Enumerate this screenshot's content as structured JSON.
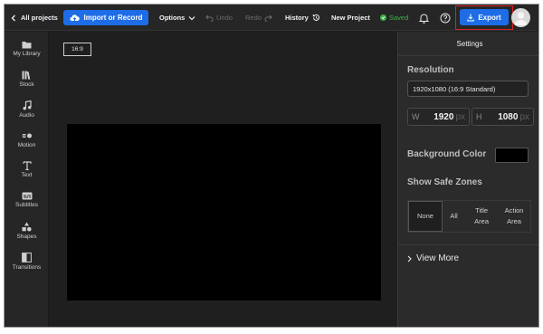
{
  "topbar": {
    "all_projects": "All projects",
    "import_record": "Import or Record",
    "options": "Options",
    "undo": "Undo",
    "redo": "Redo",
    "history": "History",
    "new_project": "New Project",
    "saved": "Saved",
    "export": "Export"
  },
  "sidebar": {
    "items": [
      {
        "label": "My Library",
        "icon": "folder-icon"
      },
      {
        "label": "Stock",
        "icon": "stock-icon"
      },
      {
        "label": "Audio",
        "icon": "music-note-icon"
      },
      {
        "label": "Motion",
        "icon": "motion-icon"
      },
      {
        "label": "Text",
        "icon": "text-icon"
      },
      {
        "label": "Subtitles",
        "icon": "subtitles-icon"
      },
      {
        "label": "Shapes",
        "icon": "shapes-icon"
      },
      {
        "label": "Transitions",
        "icon": "transitions-icon"
      }
    ]
  },
  "canvas": {
    "aspect_ratio": "16:9",
    "background": "#000000"
  },
  "settings": {
    "header": "Settings",
    "resolution_title": "Resolution",
    "resolution_value": "1920x1080 (16:9 Standard)",
    "width_label": "W",
    "width_value": "1920",
    "height_label": "H",
    "height_value": "1080",
    "unit": "px",
    "background_color_title": "Background Color",
    "background_color_value": "#000000",
    "safe_zones_title": "Show Safe Zones",
    "safe_zones": {
      "none": "None",
      "all": "All",
      "title_line1": "Title",
      "title_line2": "Area",
      "action_line1": "Action",
      "action_line2": "Area"
    },
    "view_more": "View More"
  },
  "colors": {
    "accent": "#1e6de6",
    "saved": "#3bb54a",
    "highlight": "#d92323"
  }
}
